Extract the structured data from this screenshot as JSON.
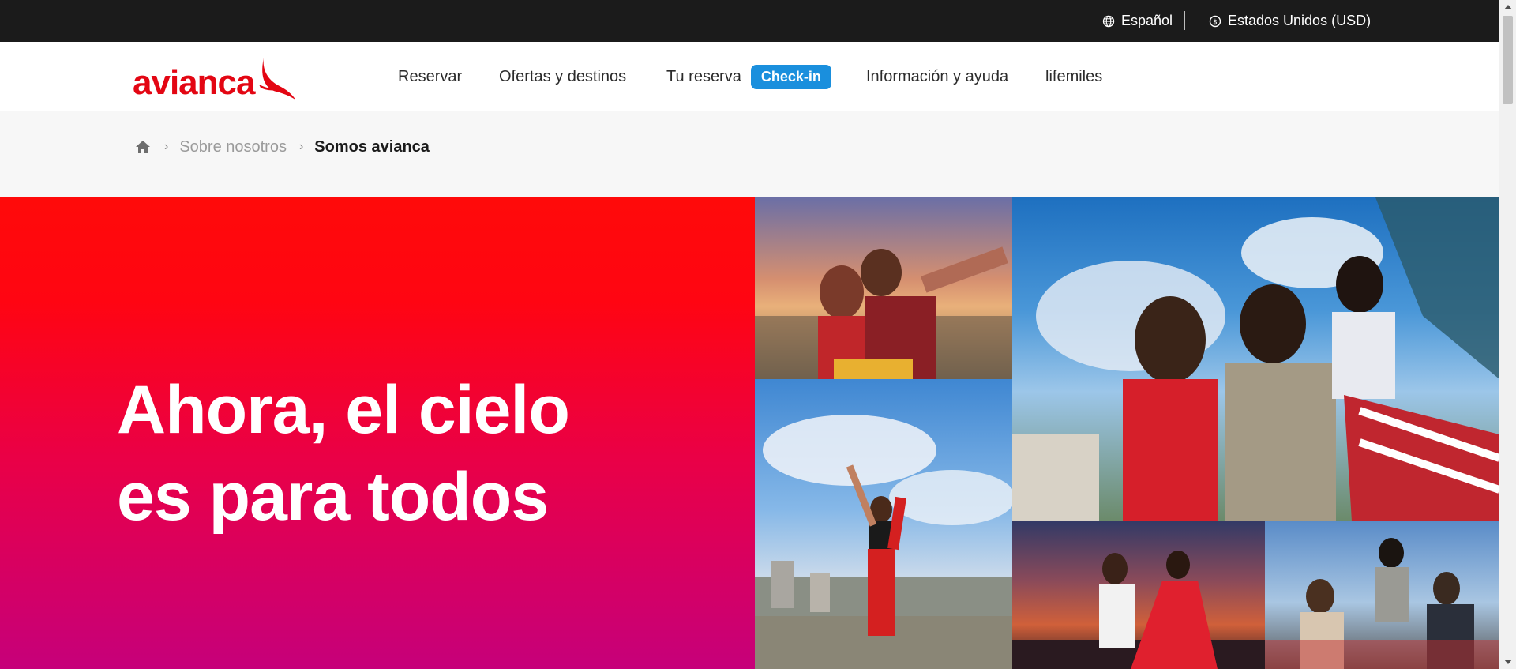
{
  "topbar": {
    "language_label": "Español",
    "language_icon": "globe-icon",
    "country_label": "Estados Unidos (USD)",
    "country_icon": "currency-icon"
  },
  "header": {
    "logo_text": "avianca",
    "nav": {
      "reservar": "Reservar",
      "ofertas": "Ofertas y destinos",
      "tu_reserva": "Tu reserva",
      "checkin": "Check-in",
      "informacion": "Información y ayuda",
      "lifemiles": "lifemiles"
    }
  },
  "breadcrumb": {
    "home_icon": "home-icon",
    "items": [
      "Sobre nosotros",
      "Somos avianca"
    ]
  },
  "hero": {
    "title_line1": "Ahora, el cielo",
    "title_line2": "es para todos",
    "photos": [
      "couple-selfie-sunset",
      "friends-dancing-rooftop",
      "woman-kicking-city-view",
      "couple-dancing-night",
      "friends-toasting-terrace"
    ]
  },
  "colors": {
    "brand_red": "#e30613",
    "checkin_blue": "#1a8fdd",
    "topbar_bg": "#1b1b1b",
    "hero_gradient_top": "#ff0a0a",
    "hero_gradient_bottom": "#c6007a"
  }
}
